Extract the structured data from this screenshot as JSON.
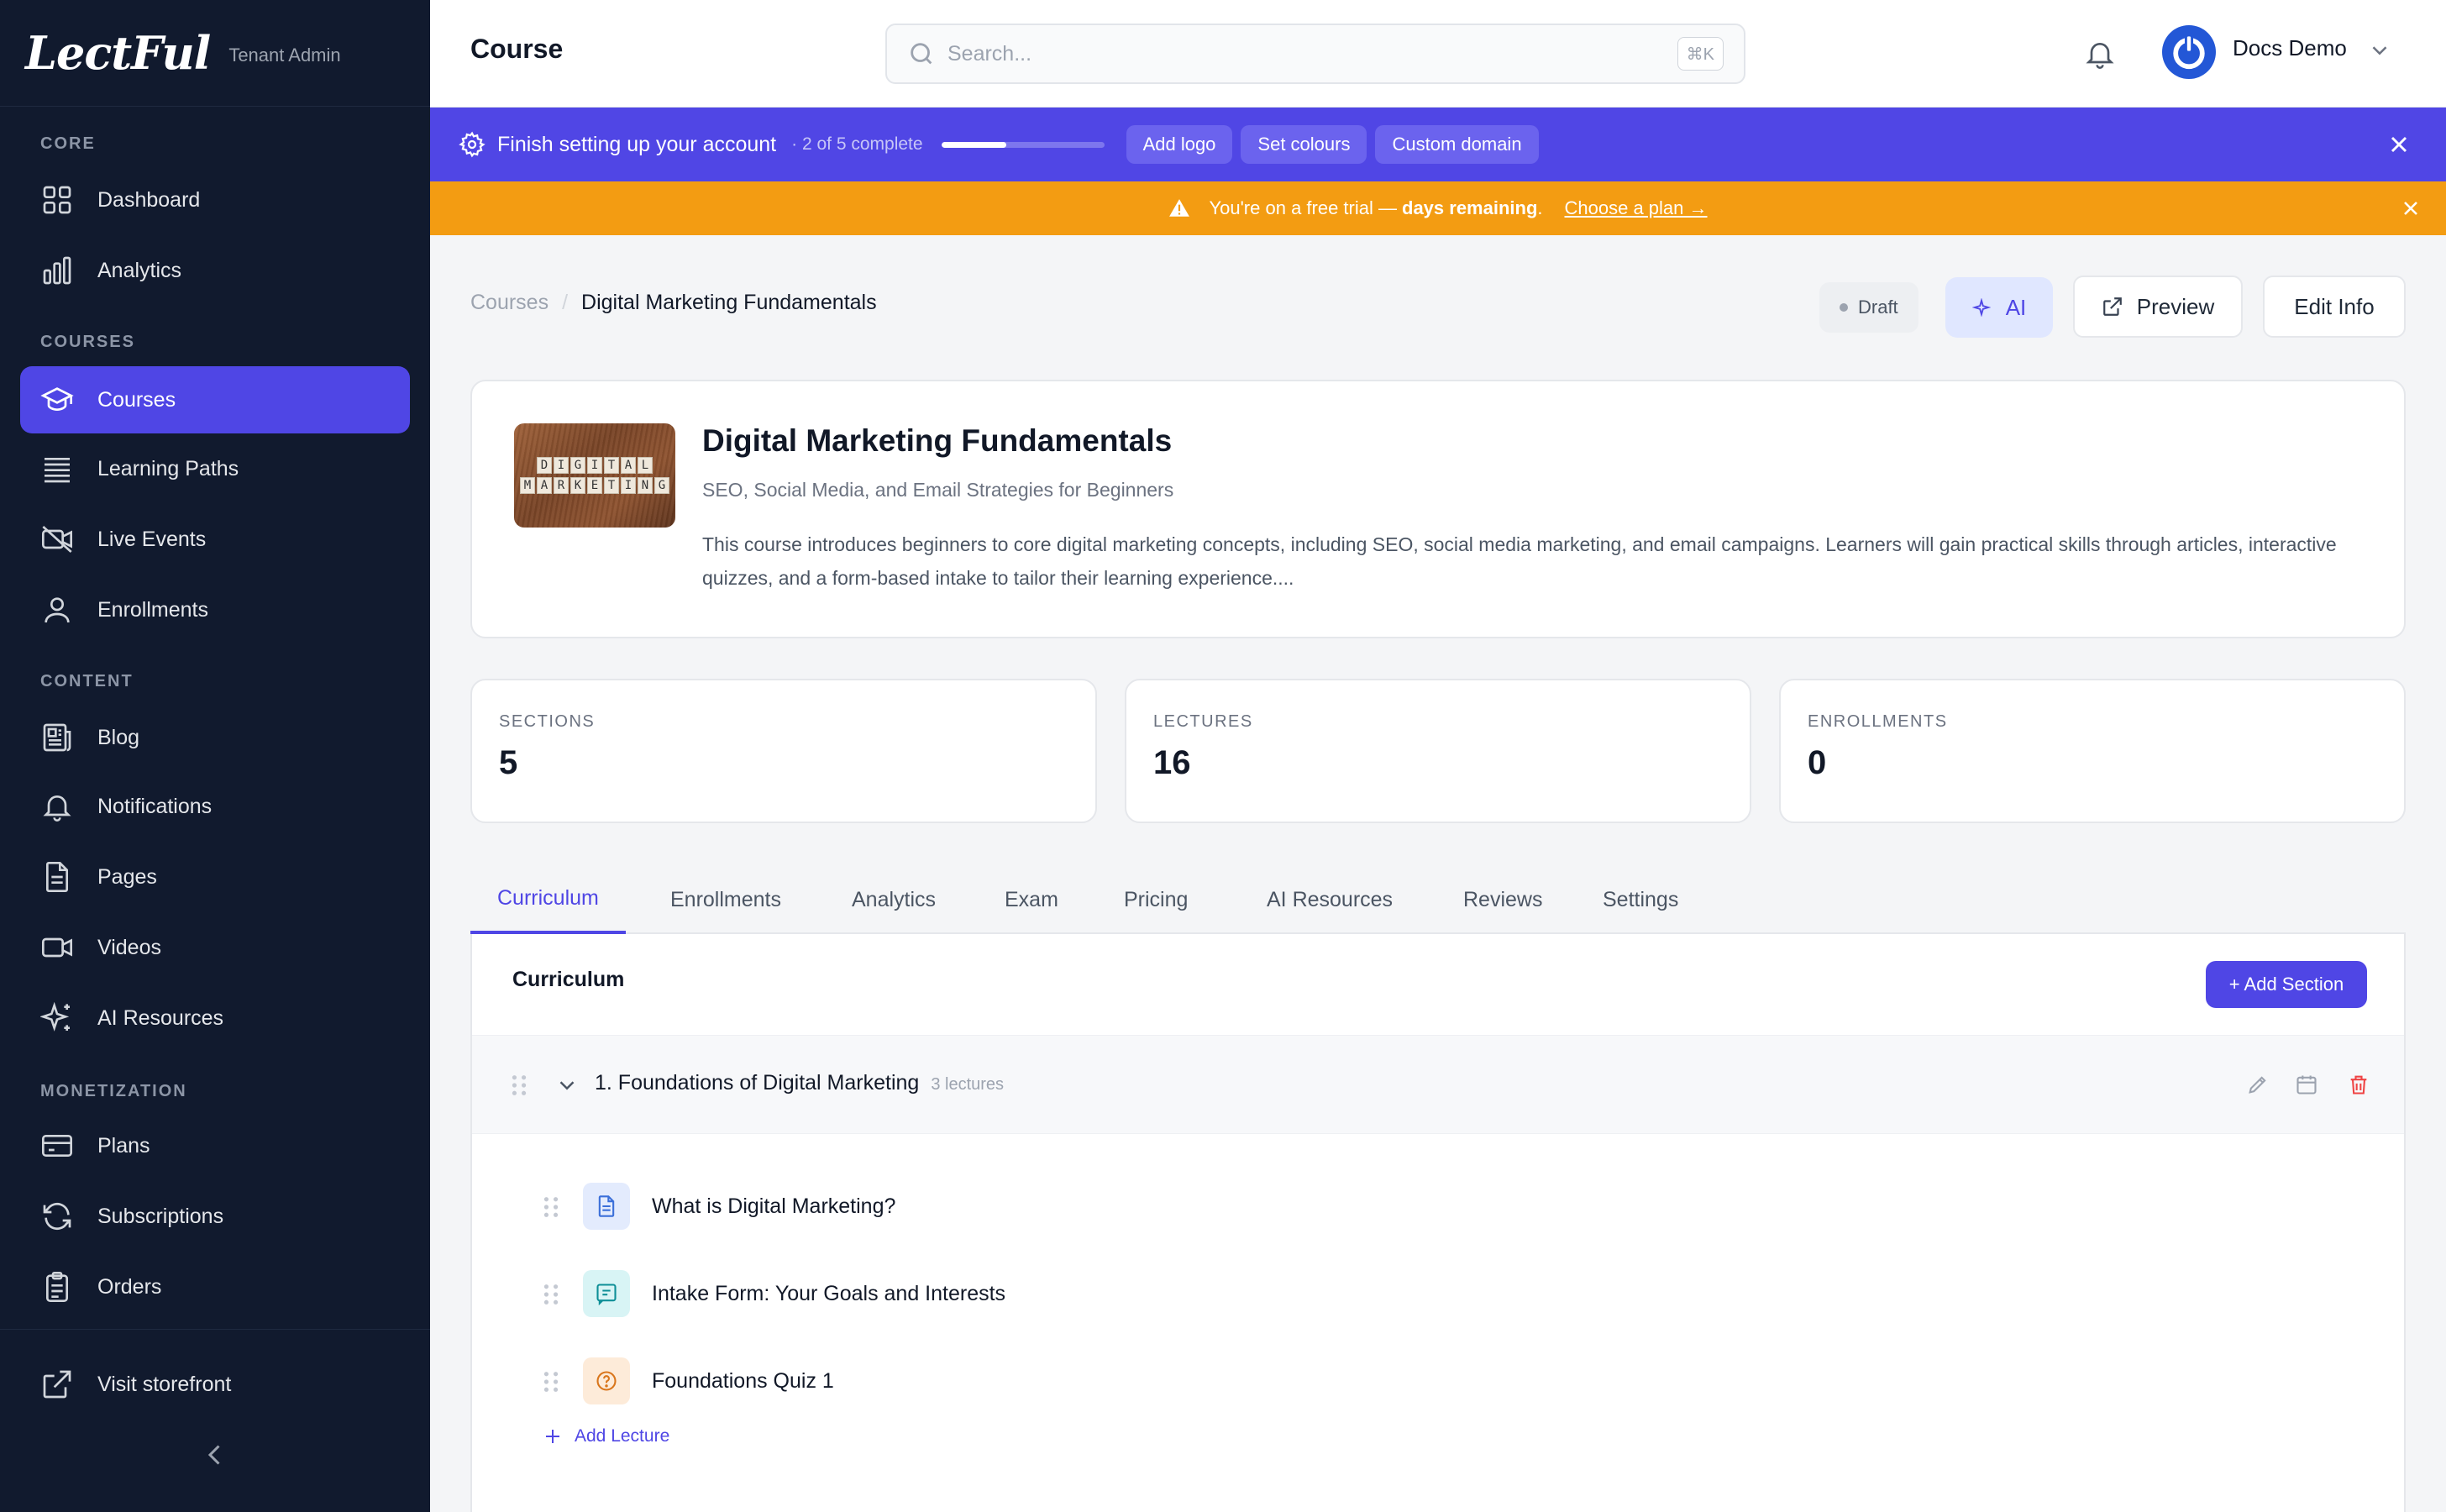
{
  "sidebar": {
    "logo": "LectFul",
    "role": "Tenant Admin",
    "groups": {
      "core": "CORE",
      "courses": "COURSES",
      "content": "CONTENT",
      "monetization": "MONETIZATION"
    },
    "items": {
      "dashboard": "Dashboard",
      "analytics": "Analytics",
      "courses": "Courses",
      "learning_paths": "Learning Paths",
      "live_events": "Live Events",
      "enrollments": "Enrollments",
      "blog": "Blog",
      "notifications": "Notifications",
      "pages": "Pages",
      "videos": "Videos",
      "ai_resources": "AI Resources",
      "plans": "Plans",
      "subscriptions": "Subscriptions",
      "orders": "Orders",
      "visit_storefront": "Visit storefront"
    },
    "active_item": "courses"
  },
  "header": {
    "title": "Course",
    "search_placeholder": "Search...",
    "search_shortcut": "⌘K",
    "user_name": "Docs Demo"
  },
  "setup_banner": {
    "title": "Finish setting up your account",
    "count": "· 2 of 5 complete",
    "progress": 0.4,
    "chips": [
      "Add logo",
      "Set colours",
      "Custom domain"
    ]
  },
  "trial_banner": {
    "text": "You're on a free trial —",
    "bold": "days remaining",
    "period": ".",
    "link": "Choose a plan →"
  },
  "breadcrumb": {
    "parent": "Courses",
    "separator": "/",
    "current": "Digital Marketing Fundamentals"
  },
  "actions": {
    "status": "Draft",
    "ai": "AI",
    "preview": "Preview",
    "edit_info": "Edit Info"
  },
  "course": {
    "title": "Digital Marketing Fundamentals",
    "subtitle": "SEO, Social Media, and Email Strategies for Beginners",
    "description": "This course introduces beginners to core digital marketing concepts, including SEO, social media marketing, and email campaigns. Learners will gain practical skills through articles, interactive quizzes, and a form-based intake to tailor their learning experience....",
    "thumbnail_row1": "DIGITAL",
    "thumbnail_row2": "MARKETING"
  },
  "stats": [
    {
      "label": "SECTIONS",
      "value": "5"
    },
    {
      "label": "LECTURES",
      "value": "16"
    },
    {
      "label": "ENROLLMENTS",
      "value": "0"
    }
  ],
  "tabs": [
    "Curriculum",
    "Enrollments",
    "Analytics",
    "Exam",
    "Pricing",
    "AI Resources",
    "Reviews",
    "Settings"
  ],
  "active_tab": "Curriculum",
  "curriculum": {
    "title": "Curriculum",
    "add_section": "+ Add Section",
    "sections": [
      {
        "title": "1. Foundations of Digital Marketing",
        "count": "3 lectures",
        "lectures": [
          {
            "title": "What is Digital Marketing?",
            "type": "article-icon"
          },
          {
            "title": "Intake Form: Your Goals and Interests",
            "type": "form-icon"
          },
          {
            "title": "Foundations Quiz 1",
            "type": "quiz-icon"
          }
        ],
        "add_lecture": "Add Lecture"
      }
    ]
  },
  "colors": {
    "sidebar_bg": "#111a2e",
    "accent": "#4f46e5",
    "setup_banner": "#5046e5",
    "trial_banner": "#f39c12",
    "danger": "#ef4444"
  }
}
